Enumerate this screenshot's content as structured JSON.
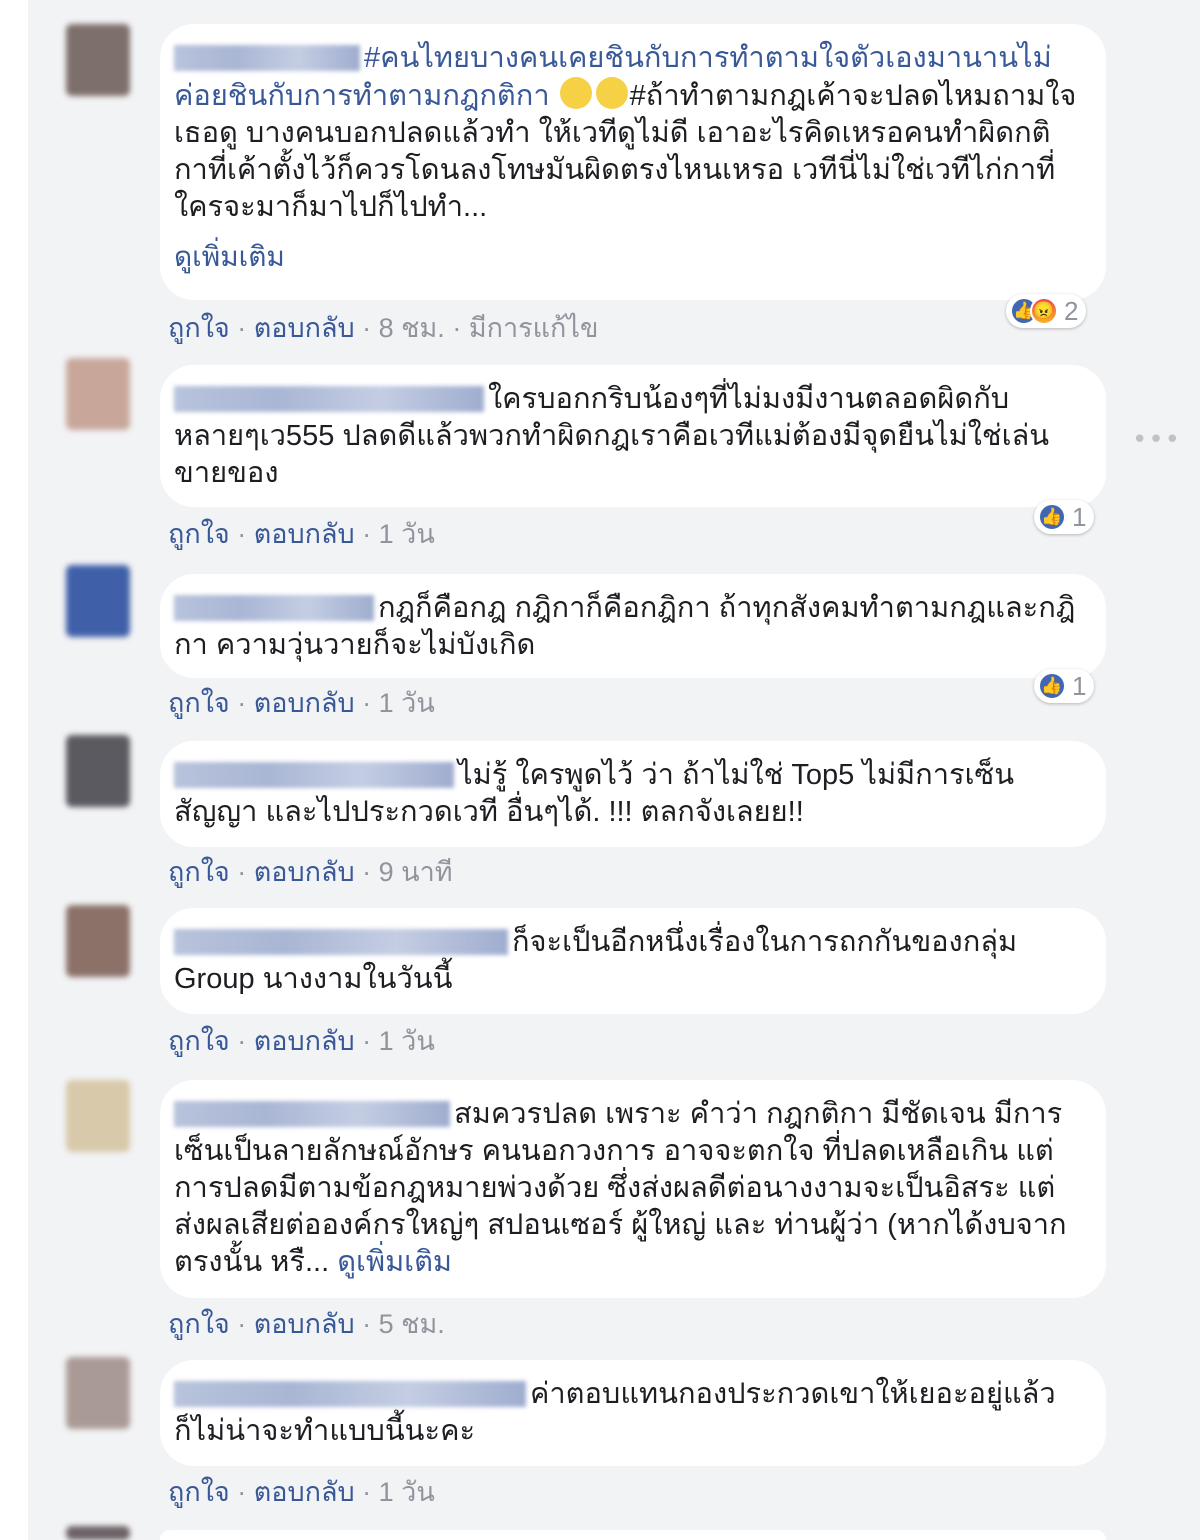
{
  "comments": [
    {
      "text_a": "#คนไทยบางคนเคยชินกับการทำตามใจตัวเองมานานไม่ค่อยชินกับการทำตามกฎกติกา",
      "text_b": "#ถ้าทำตามกฎเค้าจะปลดไหมถามใจเธอดู บางคนบอกปลดแล้วทำ ให้เวทีดูไม่ดี เอาอะไรคิดเหรอคนทำผิดกติกาที่เค้าตั้งไว้ก็ควรโดนลงโทษมันผิดตรงไหนเหรอ เวทีนี่ไม่ใช่เวทีไก่กาที่ใครจะมาก็มาไปก็ไปทำ...",
      "see_more": "ดูเพิ่มเติม",
      "like": "ถูกใจ",
      "reply": "ตอบกลับ",
      "time": "8 ชม.",
      "edited": "มีการแก้ไข",
      "reaction_count": "2"
    },
    {
      "text": "ใครบอกกริบน้องๆที่ไม่มงมีงานตลอดผิดกับหลายๆเว555 ปลดดีแล้วพวกทำผิดกฎเราคือเวทีแม่ต้องมีจุดยืนไม่ใช่เล่นขายของ",
      "like": "ถูกใจ",
      "reply": "ตอบกลับ",
      "time": "1 วัน",
      "reaction_count": "1"
    },
    {
      "text": "กฎก็คือกฎ กฎิกาก็คือกฎิกา ถ้าทุกสังคมทำตามกฎและกฎิกา ความวุ่นวายก็จะไม่บังเกิด",
      "like": "ถูกใจ",
      "reply": "ตอบกลับ",
      "time": "1 วัน",
      "reaction_count": "1"
    },
    {
      "text": "ไม่รู้ ใครพูดไว้ ว่า ถ้าไม่ใช่ Top5 ไม่มีการเซ็นสัญญา และไปประกวดเวที อื่นๆได้. !!! ตลกจังเลยย!!",
      "like": "ถูกใจ",
      "reply": "ตอบกลับ",
      "time": "9 นาที"
    },
    {
      "text": "ก็จะเป็นอีกหนึ่งเรื่องในการถกกันของกลุ่ม Group นางงามในวันนี้",
      "like": "ถูกใจ",
      "reply": "ตอบกลับ",
      "time": "1 วัน"
    },
    {
      "text": "สมควรปลด เพราะ คำว่า กฎกติกา มีชัดเจน มีการเซ็นเป็นลายลักษณ์อักษร คนนอกวงการ อาจจะตกใจ ที่ปลดเหลือเกิน แต่ การปลดมีตามข้อกฎหมายพ่วงด้วย ซึ่งส่งผลดีต่อนางงามจะเป็นอิสระ แต่ ส่งผลเสียต่อองค์กรใหญ่ๆ สปอนเซอร์ ผู้ใหญ่ และ ท่านผู้ว่า (หากได้งบจากตรงนั้น หรื...",
      "see_more": "ดูเพิ่มเติม",
      "like": "ถูกใจ",
      "reply": "ตอบกลับ",
      "time": "5 ชม."
    },
    {
      "text": "ค่าตอบแทนกองประกวดเขาให้เยอะอยู่แล้ว ก็ไม่น่าจะทำแบบนี้นะคะ",
      "like": "ถูกใจ",
      "reply": "ตอบกลับ",
      "time": "1 วัน"
    }
  ],
  "more_options": "•••",
  "colors": {
    "link": "#385898",
    "meta": "#90949c",
    "bubble": "#ffffff",
    "page": "#f2f3f5"
  },
  "icons": [
    "like-reaction-icon",
    "angry-reaction-icon",
    "roll-eyes-emoji-icon",
    "more-options-icon"
  ]
}
